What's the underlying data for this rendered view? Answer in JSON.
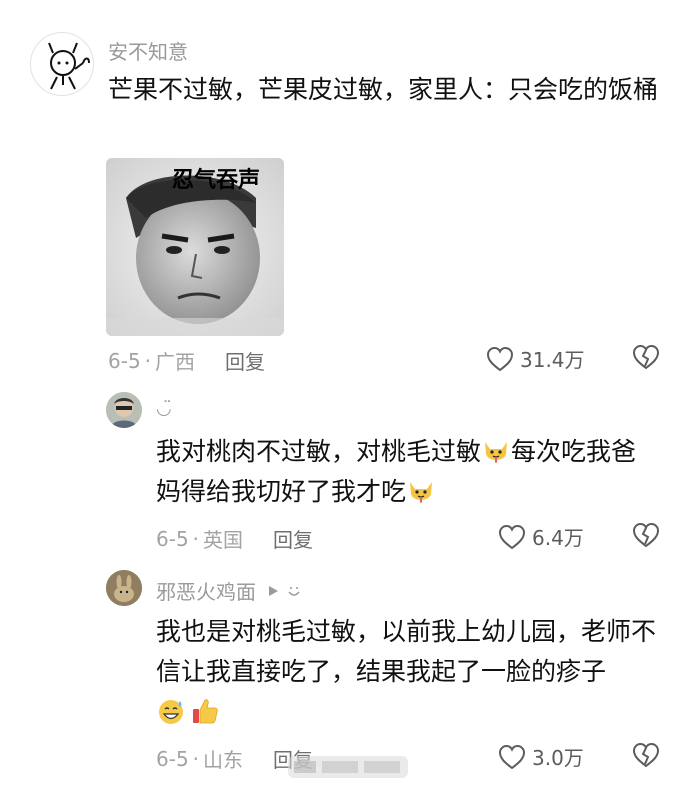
{
  "comments": [
    {
      "username": "安不知意",
      "text": "芒果不过敏，芒果皮过敏，家里人：只会吃的饭桶",
      "image_caption": "忍气吞声",
      "date": "6-5",
      "location": "广西",
      "reply_label": "回复",
      "likes": "31.4万"
    },
    {
      "username": "◡̈",
      "text": "我对桃肉不过敏，对桃毛过敏",
      "text_after_emoji": "每次吃我爸妈得给我切好了我才吃",
      "date": "6-5",
      "location": "英国",
      "reply_label": "回复",
      "likes": "6.4万"
    },
    {
      "username": "邪恶火鸡面",
      "text": "我也是对桃毛过敏，以前我上幼儿园，老师不信让我直接吃了，结果我起了一脸的疹子",
      "date": "6-5",
      "location": "山东",
      "reply_label": "回复",
      "likes": "3.0万"
    }
  ],
  "separator": "·",
  "icons": {
    "like": "heart-outline-icon",
    "dislike": "broken-heart-icon",
    "play": "play-triangle-icon",
    "smile": "smile-icon",
    "emoji_dog": "dog-tongue-emoji",
    "emoji_grin": "grin-sweat-emoji",
    "emoji_thumb": "thumbs-up-emoji"
  },
  "colors": {
    "meta": "#a3a3a3",
    "reply": "#6f6f6f",
    "text": "#111111"
  }
}
